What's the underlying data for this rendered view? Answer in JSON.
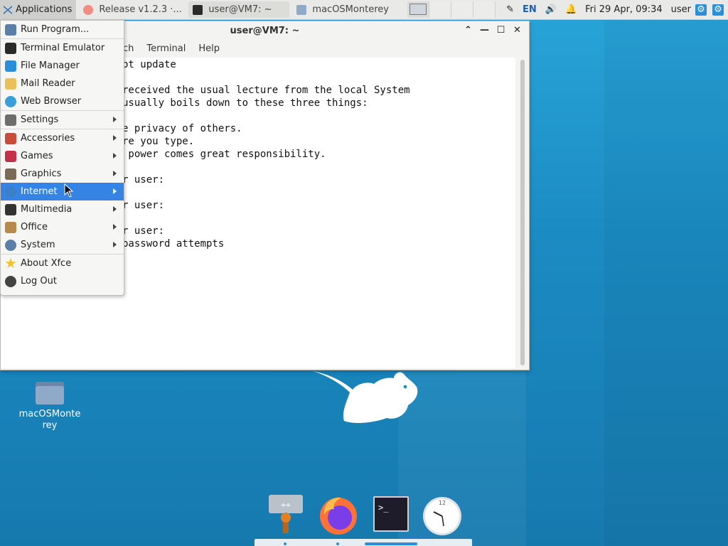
{
  "panel": {
    "applications_label": "Applications",
    "tasks": [
      {
        "label": "Release v1.2.3 ·...",
        "icon": "firefox-icon"
      },
      {
        "label": "user@VM7: ~",
        "icon": "terminal-icon"
      },
      {
        "label": "macOSMonterey",
        "icon": "folder-icon"
      }
    ],
    "tray": {
      "language": "EN",
      "clock": "Fri 29 Apr, 09:34",
      "user": "user"
    }
  },
  "terminal": {
    "title": "user@VM7: ~",
    "menus": [
      "ch",
      "Terminal",
      "Help"
    ],
    "lines": [
      "ot update",
      "",
      "received the usual lecture from the local System",
      "usually boils down to these three things:",
      "",
      "e privacy of others.",
      "re you type.",
      " power comes great responsibility.",
      "",
      "r user:",
      "",
      "r user:",
      "",
      "r user:",
      "password attempts"
    ]
  },
  "app_menu": {
    "items": [
      {
        "label": "Run Program...",
        "icon": "run-program-icon",
        "color": "#5a7fa8",
        "submenu": false
      },
      {
        "label": "Terminal Emulator",
        "icon": "terminal-icon",
        "color": "#2b2b2b",
        "submenu": false
      },
      {
        "label": "File Manager",
        "icon": "file-manager-icon",
        "color": "#2a8fd8",
        "submenu": false
      },
      {
        "label": "Mail Reader",
        "icon": "mail-icon",
        "color": "#e8c15a",
        "submenu": false
      },
      {
        "label": "Web Browser",
        "icon": "globe-icon",
        "color": "#3a9fd8",
        "submenu": false
      },
      {
        "label": "Settings",
        "icon": "settings-icon",
        "color": "#6e6e6e",
        "submenu": true
      },
      {
        "label": "Accessories",
        "icon": "accessories-icon",
        "color": "#c94c3a",
        "submenu": true
      },
      {
        "label": "Games",
        "icon": "games-icon",
        "color": "#c2304a",
        "submenu": true
      },
      {
        "label": "Graphics",
        "icon": "graphics-icon",
        "color": "#7a6a55",
        "submenu": true
      },
      {
        "label": "Internet",
        "icon": "internet-icon",
        "color": "#3a7fc8",
        "submenu": true,
        "highlighted": true
      },
      {
        "label": "Multimedia",
        "icon": "multimedia-icon",
        "color": "#333333",
        "submenu": true
      },
      {
        "label": "Office",
        "icon": "office-icon",
        "color": "#b58a4a",
        "submenu": true
      },
      {
        "label": "System",
        "icon": "system-icon",
        "color": "#5a7fa8",
        "submenu": true
      },
      {
        "label": "About Xfce",
        "icon": "star-icon",
        "color": "#f2c12e",
        "submenu": false
      },
      {
        "label": "Log Out",
        "icon": "logout-icon",
        "color": "#444444",
        "submenu": false
      }
    ]
  },
  "desktop": {
    "folder_label": "macOSMonterey"
  },
  "dock": {
    "items": [
      "app-finder-icon",
      "firefox-icon",
      "terminal-icon",
      "clock-icon"
    ]
  },
  "colors": {
    "accent": "#3584e4",
    "desktop": "#1a8fc4"
  }
}
